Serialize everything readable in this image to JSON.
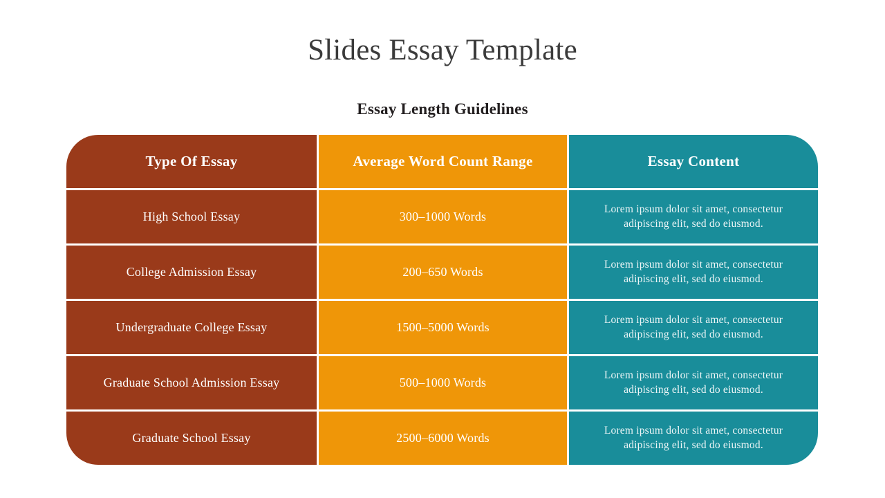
{
  "slide": {
    "title": "Slides Essay Template",
    "subtitle": "Essay Length Guidelines"
  },
  "colors": {
    "brown": "#9a3a1a",
    "orange": "#ef9608",
    "teal": "#198d9a",
    "title_text": "#3b3b3b",
    "subtitle_text": "#231f20",
    "cell_text": "#ffffff",
    "background": "#ffffff"
  },
  "table": {
    "headers": [
      "Type Of Essay",
      "Average Word Count Range",
      "Essay Content"
    ],
    "rows": [
      {
        "type": "High School Essay",
        "word_count": "300–1000 Words",
        "content": "Lorem ipsum dolor sit amet, consectetur adipiscing elit, sed do eiusmod."
      },
      {
        "type": "College Admission Essay",
        "word_count": "200–650 Words",
        "content": "Lorem ipsum dolor sit amet, consectetur adipiscing elit, sed do eiusmod."
      },
      {
        "type": "Undergraduate College Essay",
        "word_count": "1500–5000 Words",
        "content": "Lorem ipsum dolor sit amet, consectetur adipiscing elit, sed do eiusmod."
      },
      {
        "type": "Graduate School Admission Essay",
        "word_count": "500–1000 Words",
        "content": "Lorem ipsum dolor sit amet, consectetur adipiscing elit, sed do eiusmod."
      },
      {
        "type": "Graduate School Essay",
        "word_count": "2500–6000 Words",
        "content": "Lorem ipsum dolor sit amet, consectetur adipiscing elit, sed do eiusmod."
      }
    ]
  }
}
